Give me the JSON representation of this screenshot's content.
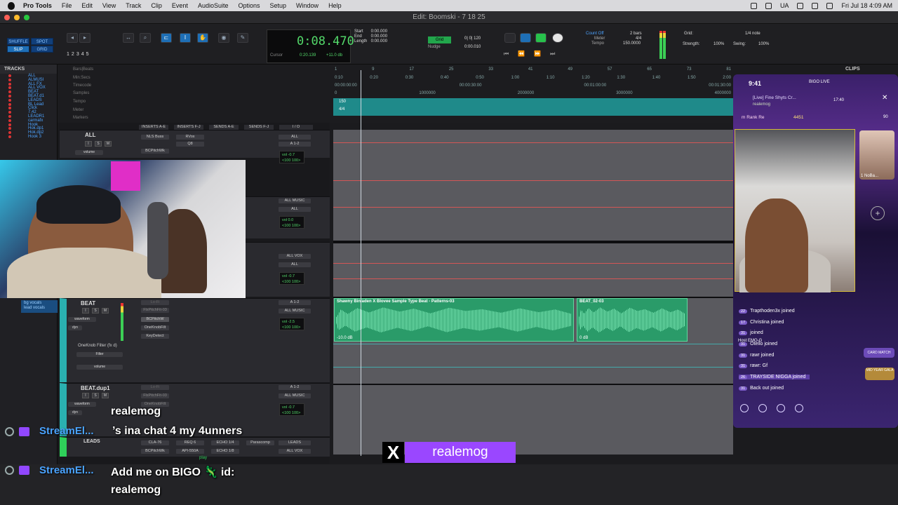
{
  "menubar": {
    "app": "Pro Tools",
    "items": [
      "File",
      "Edit",
      "View",
      "Track",
      "Clip",
      "Event",
      "AudioSuite",
      "Options",
      "Setup",
      "Window",
      "Help"
    ],
    "lang": "UA",
    "datetime": "Fri Jul 18  4:09 AM"
  },
  "window": {
    "title": "Edit: Boomski - 7 18 25"
  },
  "toolbar": {
    "modes": [
      "SHUFFLE",
      "SPOT",
      "SLIP",
      "GRID"
    ],
    "zoom_presets": [
      "1",
      "2",
      "3",
      "4",
      "5"
    ],
    "counter": {
      "main": "0:08.470",
      "cursor_label": "Cursor",
      "cursor_value": "0:20.139",
      "offset": "+11.0 db",
      "start_label": "Start",
      "end_label": "End",
      "length_label": "Length",
      "start": "0:00.000",
      "end": "0:00.000",
      "length": "0:00.000"
    },
    "grid_label": "Grid",
    "nudge_label": "Nudge",
    "grid_value": "0| 0| 120",
    "nudge_value": "0:00.010",
    "count_off": "Count Off",
    "meter_label": "Meter",
    "tempo_label": "Tempo",
    "bars": "2 bars",
    "meter_value": "4/4",
    "tempo_value": "150.0000",
    "grid_right_label": "Grid:",
    "grid_right_value": "1/4 note",
    "strength_label": "Strength:",
    "strength_value": "100%",
    "swing_label": "Swing:",
    "swing_value": "100%"
  },
  "tracks_panel": {
    "title": "TRACKS",
    "items": [
      "ALL",
      "ALMUSI",
      "ALL FX",
      "ALL VOX",
      "BEAT",
      "BEAT.d1",
      "LEADS",
      "BL Lead",
      "Click",
      "7.42",
      "LEADR1",
      "carmafx",
      "Hook",
      "Hok.dp1",
      "Hok.dp2",
      "Hook 3"
    ],
    "clip_list": [
      "bg vocals",
      "lead vocals"
    ]
  },
  "rulers": {
    "names": [
      "Bars|Beats",
      "Min:Secs",
      "Timecode",
      "Samples",
      "Tempo",
      "Meter",
      "Markers"
    ],
    "bars": [
      "1",
      "9",
      "17",
      "25",
      "33",
      "41",
      "49",
      "57",
      "65",
      "73",
      "81"
    ],
    "minsecs": [
      "0:10",
      "0:20",
      "0:30",
      "0:40",
      "0:50",
      "1:00",
      "1:10",
      "1:20",
      "1:30",
      "1:40",
      "1:50",
      "2:00"
    ],
    "timecode": [
      "00:00:00:00",
      "00:00:30:00",
      "00:01:00:00",
      "00:01:30:00"
    ],
    "samples": [
      "0",
      "1000000",
      "2000000",
      "3000000",
      "4000000"
    ],
    "tempo_mark": "150",
    "meter_mark": "4/4"
  },
  "columns": [
    "INSERTS A-E",
    "INSERTS F-J",
    "SENDS A-E",
    "SENDS F-J",
    "I / O"
  ],
  "tracks": [
    {
      "name": "ALL",
      "inserts": [
        "NLS Buss",
        "BCPitchWk"
      ],
      "inserts2": [
        "RVox",
        "Q8"
      ],
      "io_in": "ALL",
      "io_out": "A 1-2",
      "vol": "vol   -0.7",
      "pan": "<100  100>",
      "mode": "volume"
    },
    {
      "name": "",
      "io_in": "ALL MUSIC",
      "io_out": "ALL",
      "vol": "vol    0.0",
      "pan": "<100  100>"
    },
    {
      "name": "",
      "io_in": "ALL VOX",
      "io_out": "ALL",
      "vol": "vol   -0.7",
      "pan": "<100  100>"
    },
    {
      "name": "BEAT",
      "inserts": [
        "Lo-Fi",
        "FlxPitchFit-03",
        "BCPitchW",
        "OneKnobFilt",
        "KeyDetect"
      ],
      "io_in": "A 1-2",
      "io_out": "ALL MUSIC",
      "vol": "vol   -2.5",
      "pan": "<100  100>",
      "mode": "waveform",
      "mode2": "dyn",
      "plugin": "OneKnob Filter (fx d)",
      "param": "Filter",
      "param2": "volume"
    },
    {
      "name": "BEAT.dup1",
      "inserts": [
        "Lo-Fi",
        "FlxPitchFit-03",
        "OneKnobFilt"
      ],
      "io_in": "A 1-2",
      "io_out": "ALL MUSIC",
      "vol": "vol   -0.7",
      "pan": "<100  100>",
      "mode": "waveform",
      "mode2": "dyn"
    },
    {
      "name": "LEADS",
      "inserts": [
        "CLA-76",
        "BCPitchWk"
      ],
      "inserts2": [
        "REQ 6",
        "API-550A"
      ],
      "sends": [
        "ECHO 1/4",
        "ECHO 1/8"
      ],
      "send2": "Parascomp",
      "io_in": "LEADS",
      "io_out": "ALL VOX"
    }
  ],
  "clips": [
    {
      "name": "Shawny Binladen X Blovee Sample Type Beat - Patterns-03",
      "gain": "-10.0 dB"
    },
    {
      "name": "BEAT_02-03",
      "gain": "0 dB"
    }
  ],
  "clips_panel": {
    "title": "CLIPS"
  },
  "bigo": {
    "time": "9:41",
    "app": "BIGO LIVE",
    "title": "[Live] Fine Shyts Cr...",
    "subtitle": "realemog",
    "viewers": "17:40",
    "rank": "m Rank  Re",
    "coins": "4451",
    "host": "Host",
    "host_name": "EMO-G",
    "side_name": "1 NoBa...",
    "side_count": "90",
    "chat": [
      {
        "lvl": "22",
        "text": "Trapthoden3x joined"
      },
      {
        "lvl": "17",
        "text": "Christina  joined"
      },
      {
        "lvl": "31",
        "text": "joined"
      },
      {
        "lvl": "31",
        "text": "Otello joined"
      },
      {
        "lvl": "31",
        "text": "rawr joined"
      },
      {
        "lvl": "31",
        "text": "rawr: Gf"
      },
      {
        "lvl": "26",
        "text": "TRAYSIDE NIGGA joined"
      },
      {
        "lvl": "31",
        "text": "Back out joined"
      }
    ],
    "badge1": "CARD MATCH",
    "badge2": "MID YEAR GALA"
  },
  "overlay": {
    "chat_user": "realemog",
    "chat_msg": "’s ina chat 4 my 4unners",
    "bot": "StreamEl...",
    "bot_msg_line1": "Add me on BIGO 🦎 id:",
    "bot_msg_line2": "realemog",
    "x_handle": "realemog",
    "play_label": "play"
  }
}
